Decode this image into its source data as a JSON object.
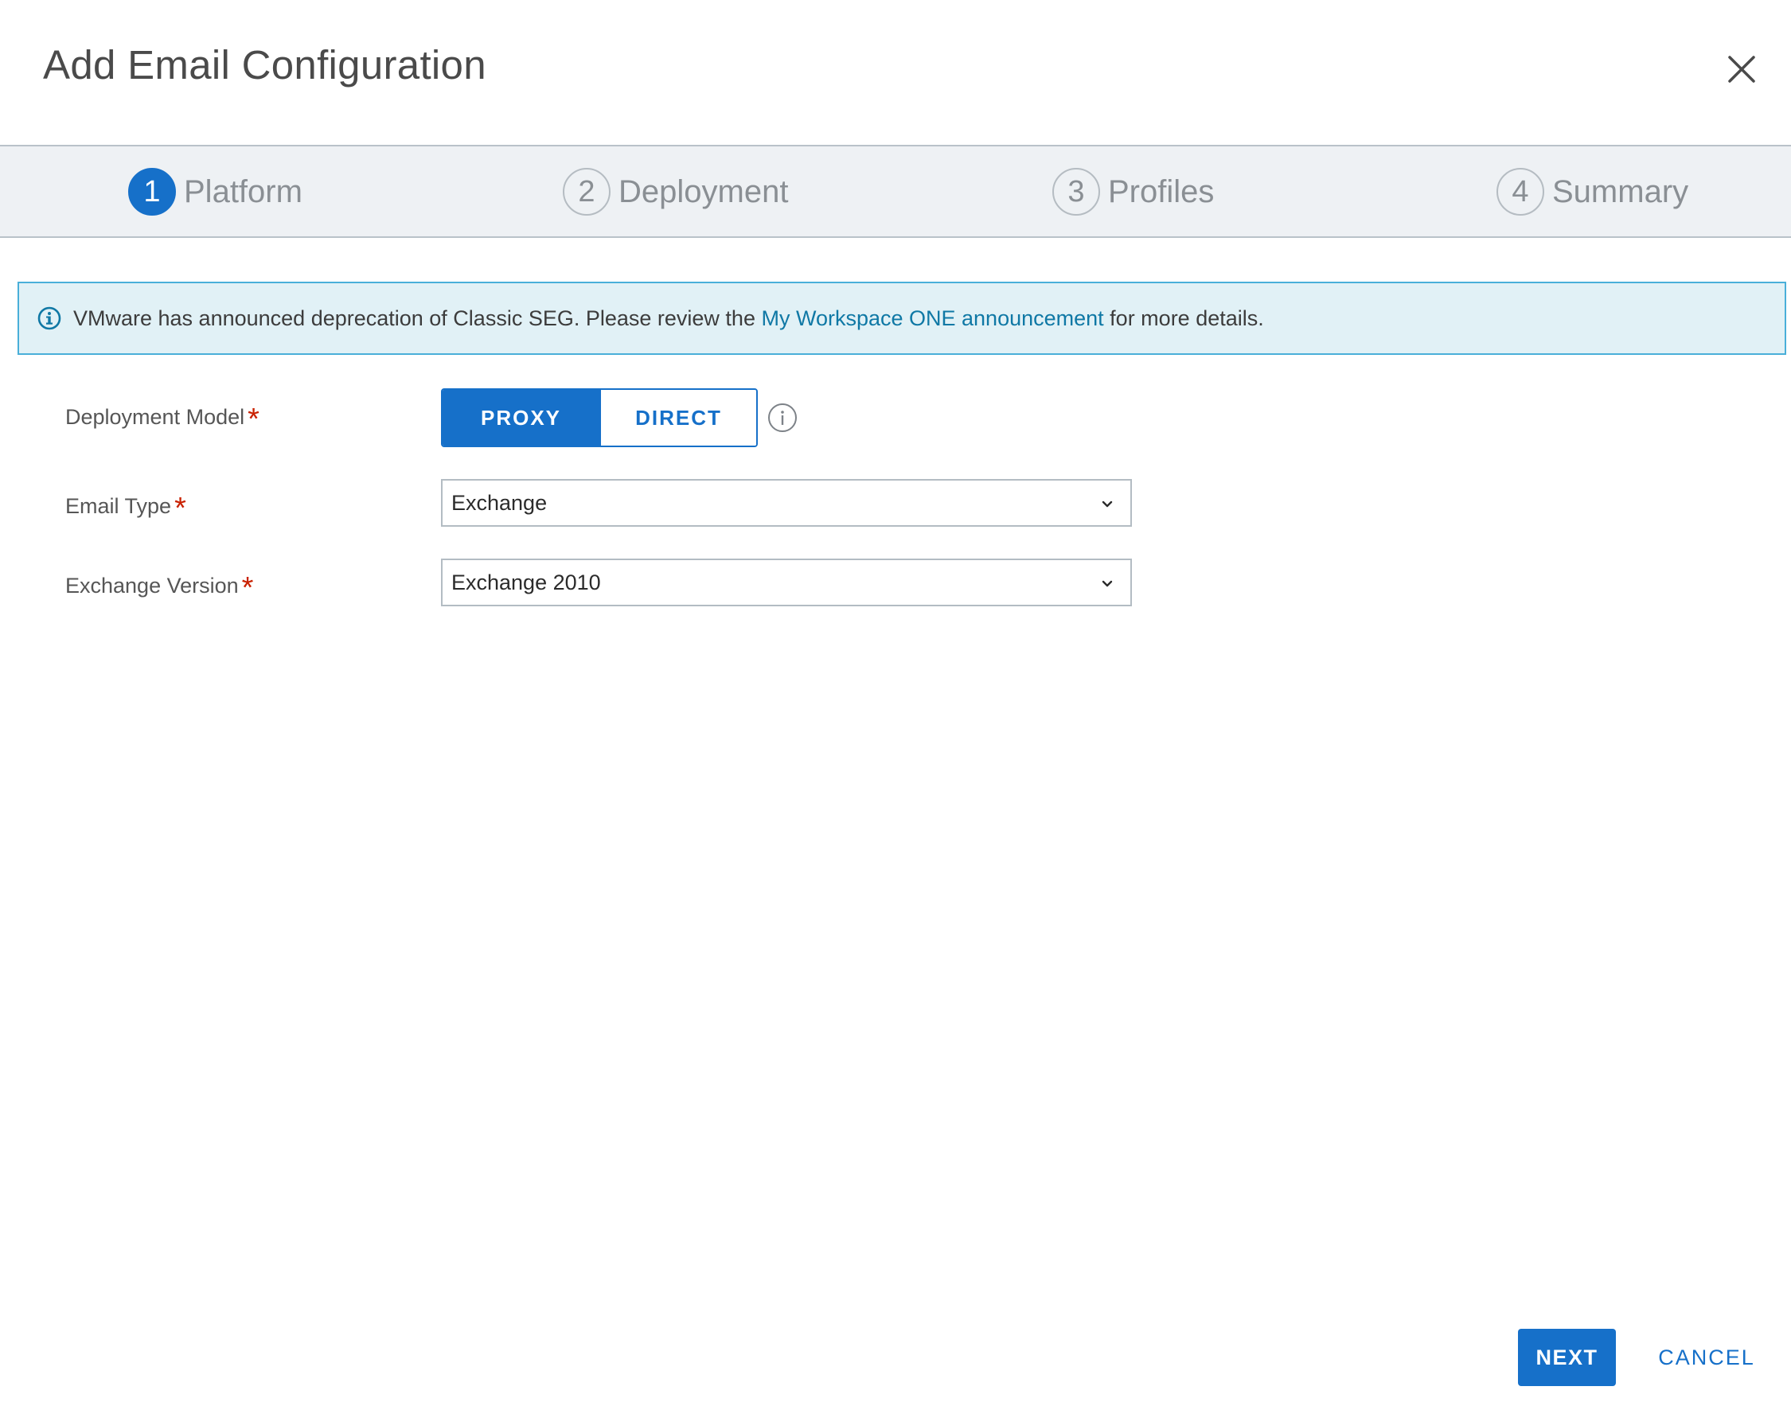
{
  "dialog": {
    "title": "Add Email Configuration"
  },
  "steps": [
    {
      "number": "1",
      "label": "Platform",
      "active": true
    },
    {
      "number": "2",
      "label": "Deployment",
      "active": false
    },
    {
      "number": "3",
      "label": "Profiles",
      "active": false
    },
    {
      "number": "4",
      "label": "Summary",
      "active": false
    }
  ],
  "banner": {
    "text_before": "VMware has announced deprecation of Classic SEG. Please review the ",
    "link_text": "My Workspace ONE announcement",
    "text_after": " for more details."
  },
  "form": {
    "deployment_model": {
      "label": "Deployment Model",
      "required_mark": "*",
      "options": [
        "PROXY",
        "DIRECT"
      ],
      "selected": "PROXY"
    },
    "email_type": {
      "label": "Email Type",
      "required_mark": "*",
      "value": "Exchange"
    },
    "exchange_version": {
      "label": "Exchange Version",
      "required_mark": "*",
      "value": "Exchange 2010"
    }
  },
  "footer": {
    "next_label": "NEXT",
    "cancel_label": "CANCEL"
  },
  "colors": {
    "primary": "#1670c9",
    "required": "#c92100",
    "banner_bg": "#e1f1f6",
    "banner_border": "#49afd9",
    "stepper_bg": "#eef1f4"
  }
}
